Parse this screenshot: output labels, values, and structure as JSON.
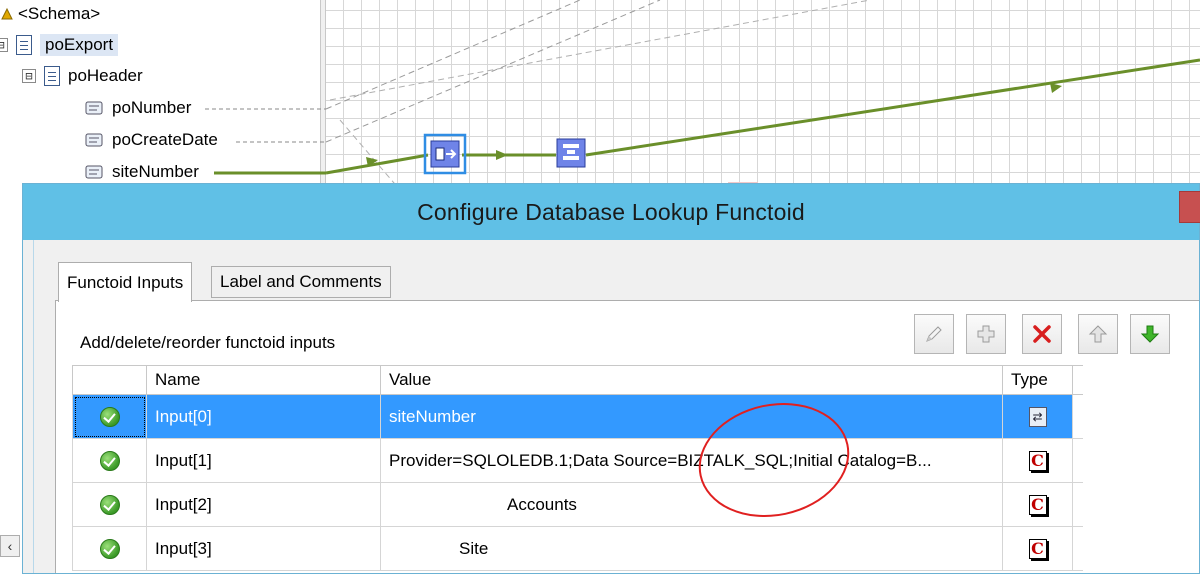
{
  "schema_tree": {
    "root_label": "<Schema>",
    "nodes": [
      {
        "label": "poExport",
        "expander": "⊟",
        "kind": "record"
      },
      {
        "label": "poHeader",
        "expander": "⊟",
        "kind": "record"
      },
      {
        "label": "poNumber",
        "kind": "field"
      },
      {
        "label": "poCreateDate",
        "kind": "field"
      },
      {
        "label": "siteNumber",
        "kind": "field"
      }
    ]
  },
  "dialog": {
    "title": "Configure Database Lookup Functoid",
    "tabs": [
      {
        "label": "Functoid Inputs",
        "active": true
      },
      {
        "label": "Label and Comments",
        "active": false
      }
    ],
    "panel_label": "Add/delete/reorder functoid inputs",
    "toolbar": [
      {
        "name": "edit-button",
        "icon": "pencil-icon",
        "enabled": false
      },
      {
        "name": "add-button",
        "icon": "plus-icon",
        "enabled": false
      },
      {
        "name": "delete-button",
        "icon": "red-x-icon",
        "enabled": true
      },
      {
        "name": "move-up-button",
        "icon": "up-arrow-icon",
        "enabled": false
      },
      {
        "name": "move-down-button",
        "icon": "green-down-arrow-icon",
        "enabled": true
      }
    ],
    "grid": {
      "headers": {
        "name": "Name",
        "value": "Value",
        "type": "Type"
      },
      "rows": [
        {
          "name": "Input[0]",
          "value": "siteNumber",
          "type_icon": "link-type-icon",
          "selected": true
        },
        {
          "name": "Input[1]",
          "value": "Provider=SQLOLEDB.1;Data Source=BIZTALK_SQL;Initial Catalog=B...",
          "type_icon": "constant-icon",
          "selected": false
        },
        {
          "name": "Input[2]",
          "value": "Accounts",
          "type_icon": "constant-icon",
          "selected": false
        },
        {
          "name": "Input[3]",
          "value": "Site",
          "type_icon": "constant-icon",
          "selected": false
        }
      ]
    },
    "constant_glyph": "C",
    "link_glyph": "⇄"
  },
  "colors": {
    "title_bar": "#60c0e6",
    "link_line": "#6a8f2a",
    "selection": "#3399ff",
    "annotation": "#e02020"
  }
}
